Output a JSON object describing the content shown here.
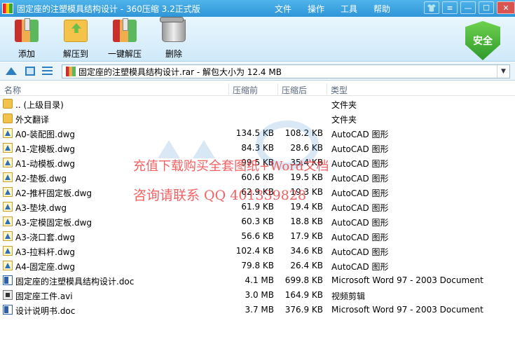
{
  "window": {
    "title": "固定座的注塑模具结构设计 - 360压缩 3.2正式版",
    "menu": [
      "文件",
      "操作",
      "工具",
      "帮助"
    ]
  },
  "toolbar": {
    "add_label": "添加",
    "extract_label": "解压到",
    "one_click_label": "一键解压",
    "delete_label": "删除",
    "security_badge": "安全"
  },
  "address": {
    "path": "固定座的注塑模具结构设计.rar - 解包大小为 12.4 MB"
  },
  "columns": {
    "name": "名称",
    "compressed": "压缩前",
    "after": "压缩后",
    "type": "类型"
  },
  "files": [
    {
      "icon": "folder",
      "name": ".. (上级目录)",
      "size": "",
      "comp": "",
      "type": "文件夹"
    },
    {
      "icon": "folder",
      "name": "外文翻译",
      "size": "",
      "comp": "",
      "type": "文件夹"
    },
    {
      "icon": "dwg",
      "name": "A0-装配图.dwg",
      "size": "134.5 KB",
      "comp": "108.2 KB",
      "type": "AutoCAD 图形"
    },
    {
      "icon": "dwg",
      "name": "A1-定模板.dwg",
      "size": "84.3 KB",
      "comp": "28.6 KB",
      "type": "AutoCAD 图形"
    },
    {
      "icon": "dwg",
      "name": "A1-动模板.dwg",
      "size": "99.5 KB",
      "comp": "35.4 KB",
      "type": "AutoCAD 图形"
    },
    {
      "icon": "dwg",
      "name": "A2-垫板.dwg",
      "size": "60.6 KB",
      "comp": "19.5 KB",
      "type": "AutoCAD 图形"
    },
    {
      "icon": "dwg",
      "name": "A2-推杆固定板.dwg",
      "size": "62.9 KB",
      "comp": "19.3 KB",
      "type": "AutoCAD 图形"
    },
    {
      "icon": "dwg",
      "name": "A3-垫块.dwg",
      "size": "61.9 KB",
      "comp": "19.4 KB",
      "type": "AutoCAD 图形"
    },
    {
      "icon": "dwg",
      "name": "A3-定模固定板.dwg",
      "size": "60.3 KB",
      "comp": "18.8 KB",
      "type": "AutoCAD 图形"
    },
    {
      "icon": "dwg",
      "name": "A3-浇口套.dwg",
      "size": "56.6 KB",
      "comp": "17.9 KB",
      "type": "AutoCAD 图形"
    },
    {
      "icon": "dwg",
      "name": "A3-拉料杆.dwg",
      "size": "102.4 KB",
      "comp": "34.6 KB",
      "type": "AutoCAD 图形"
    },
    {
      "icon": "dwg",
      "name": "A4-固定座.dwg",
      "size": "79.8 KB",
      "comp": "26.4 KB",
      "type": "AutoCAD 图形"
    },
    {
      "icon": "doc",
      "name": "固定座的注塑模具结构设计.doc",
      "size": "4.1 MB",
      "comp": "699.8 KB",
      "type": "Microsoft Word 97 - 2003 Document"
    },
    {
      "icon": "avi",
      "name": "固定座工件.avi",
      "size": "3.0 MB",
      "comp": "164.9 KB",
      "type": "视频剪辑"
    },
    {
      "icon": "doc",
      "name": "设计说明书.doc",
      "size": "3.7 MB",
      "comp": "376.9 KB",
      "type": "Microsoft Word 97 - 2003 Document"
    }
  ],
  "watermark": {
    "line1": "充值下载购买全套图纸+Word文档",
    "line2": "咨询请联系  QQ 401339828"
  },
  "colors": {
    "titlebar": "#2f95d8",
    "toolbar_bg": "#cfe9f9",
    "security_green": "#2e9a2a",
    "watermark_red": "#f04040"
  }
}
